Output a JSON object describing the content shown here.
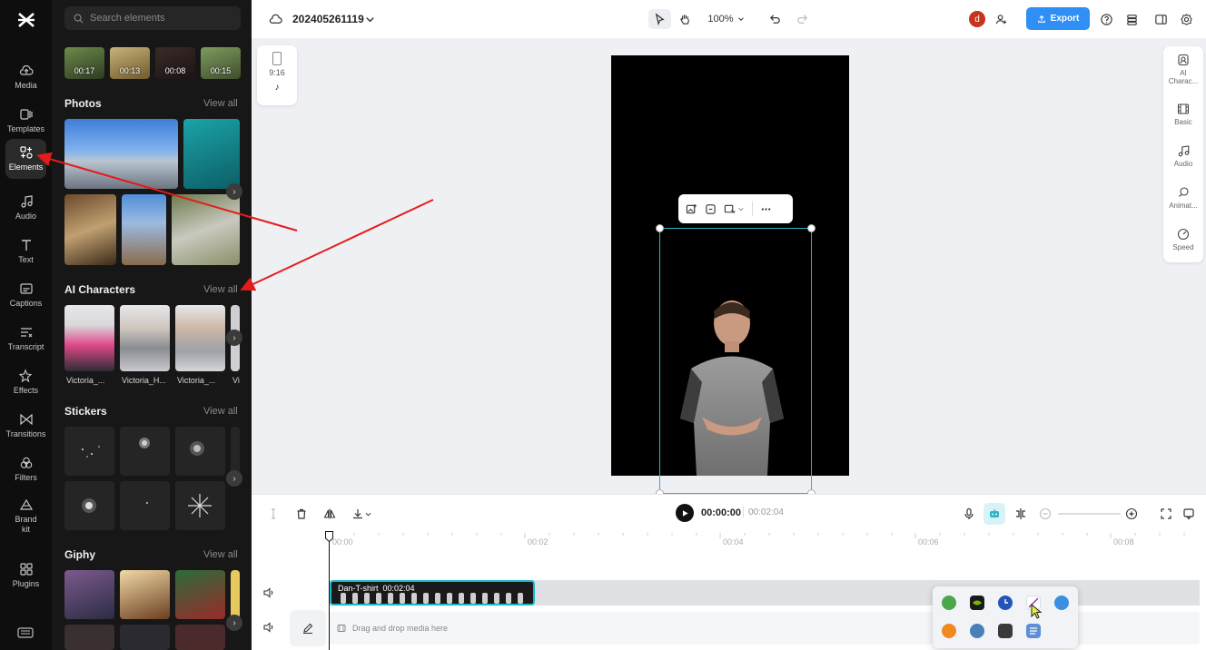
{
  "rail": {
    "items": [
      {
        "label": "Media",
        "icon": "cloud-upload-icon"
      },
      {
        "label": "Templates",
        "icon": "templates-icon"
      },
      {
        "label": "Elements",
        "icon": "elements-icon"
      },
      {
        "label": "Audio",
        "icon": "music-note-icon"
      },
      {
        "label": "Text",
        "icon": "text-icon"
      },
      {
        "label": "Captions",
        "icon": "captions-icon"
      },
      {
        "label": "Transcript",
        "icon": "transcript-icon"
      },
      {
        "label": "Effects",
        "icon": "effects-icon"
      },
      {
        "label": "Transitions",
        "icon": "transitions-icon"
      },
      {
        "label": "Filters",
        "icon": "filters-icon"
      },
      {
        "label": "Brand\nkit",
        "icon": "brand-kit-icon"
      },
      {
        "label": "Plugins",
        "icon": "plugins-icon"
      }
    ],
    "active": "Elements"
  },
  "panel": {
    "search_placeholder": "Search elements",
    "video_durations": [
      "00:17",
      "00:13",
      "00:08",
      "00:15"
    ],
    "photos_title": "Photos",
    "ai_characters_title": "AI Characters",
    "stickers_title": "Stickers",
    "giphy_title": "Giphy",
    "view_all": "View all",
    "characters": [
      "Victoria_...",
      "Victoria_H...",
      "Victoria_...",
      "Vi"
    ]
  },
  "topbar": {
    "project_name": "202405261119",
    "zoom": "100%",
    "export_label": "Export",
    "avatar_letter": "d"
  },
  "canvas": {
    "ratio_label": "9:16"
  },
  "rightbar": {
    "items": [
      {
        "label": "AI\nCharac...",
        "icon": "ai-character-icon"
      },
      {
        "label": "Basic",
        "icon": "film-icon"
      },
      {
        "label": "Audio",
        "icon": "music-note-icon"
      },
      {
        "label": "Animat...",
        "icon": "animation-icon"
      },
      {
        "label": "Speed",
        "icon": "speed-icon"
      }
    ]
  },
  "timeline": {
    "current_time": "00:00:00",
    "duration": "00:02:04",
    "ruler_labels": [
      "00:00",
      "00:02",
      "00:04",
      "00:06",
      "00:08"
    ],
    "clip_name": "Dan-T-shirt",
    "clip_duration": "00:02:04",
    "drop_text": "Drag and drop media here"
  },
  "colors": {
    "accent": "#2f8ff4",
    "selection": "#2ab4c7",
    "annotation_arrow": "#e31b1b"
  }
}
